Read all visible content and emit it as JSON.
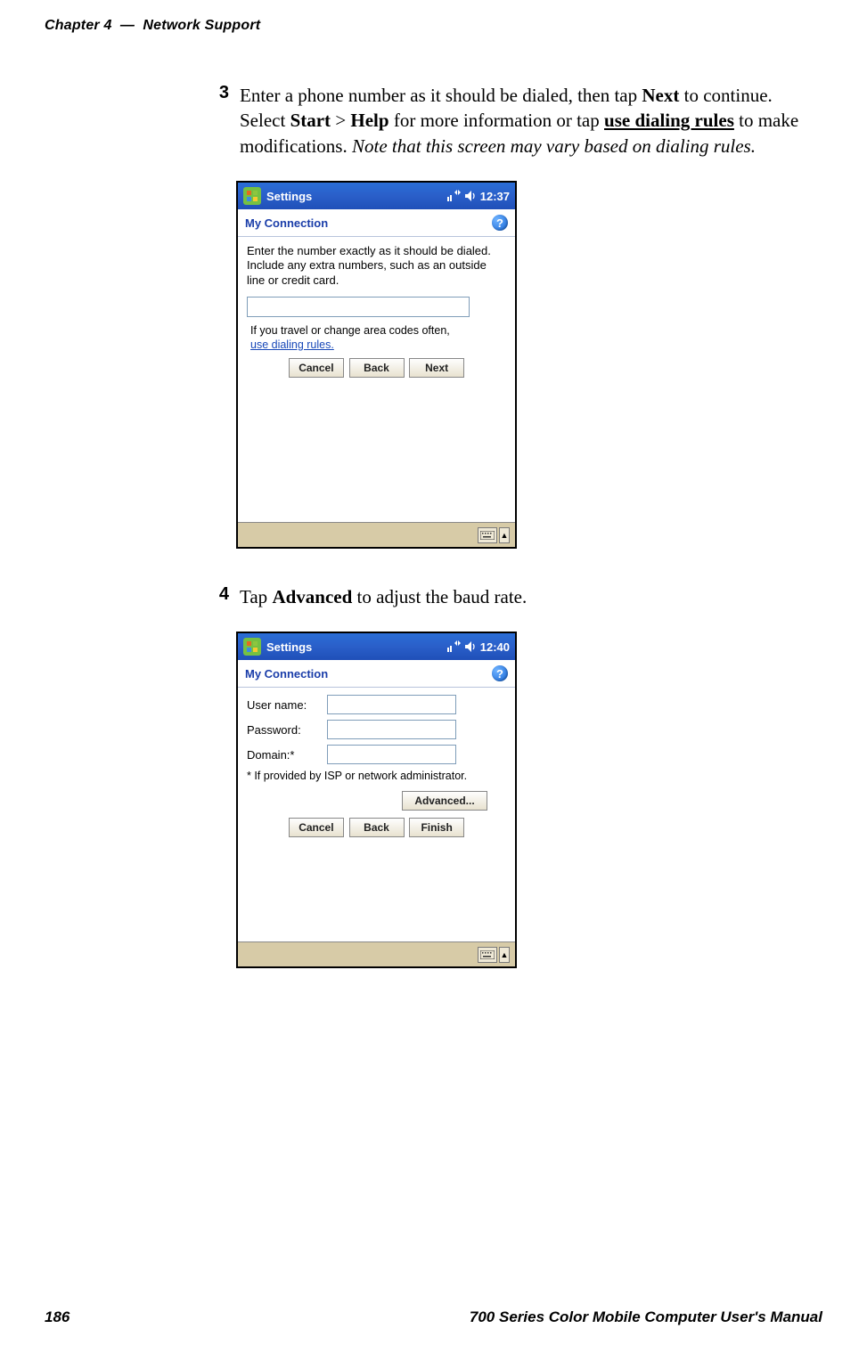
{
  "header": {
    "chapter": "Chapter 4",
    "sep": "—",
    "title": "Network Support"
  },
  "steps": {
    "s3": {
      "num": "3",
      "p1a": "Enter a phone number as it should be dialed, then tap ",
      "next": "Next",
      "p1b": " to continue. Select ",
      "start": "Start",
      "gt": " > ",
      "help": "Help",
      "p1c": " for more information or tap ",
      "udr": "use dialing rules",
      "p1d": " to make modifications. ",
      "note": "Note that this screen may vary based on dialing rules."
    },
    "s4": {
      "num": "4",
      "p1a": "Tap ",
      "adv": "Advanced",
      "p1b": " to adjust the baud rate."
    }
  },
  "shot1": {
    "title": "Settings",
    "time": "12:37",
    "subheader": "My Connection",
    "instr": "Enter the number exactly as it should be dialed.  Include any extra numbers, such as an outside line or credit card.",
    "travel": "If you travel or change area codes often,",
    "link": "use dialing rules.",
    "btn_cancel": "Cancel",
    "btn_back": "Back",
    "btn_next": "Next"
  },
  "shot2": {
    "title": "Settings",
    "time": "12:40",
    "subheader": "My Connection",
    "lbl_user": "User name:",
    "lbl_pass": "Password:",
    "lbl_domain": "Domain:*",
    "note": "* If provided by ISP or network administrator.",
    "btn_advanced": "Advanced...",
    "btn_cancel": "Cancel",
    "btn_back": "Back",
    "btn_finish": "Finish"
  },
  "footer": {
    "page": "186",
    "title": "700 Series Color Mobile Computer User's Manual"
  }
}
